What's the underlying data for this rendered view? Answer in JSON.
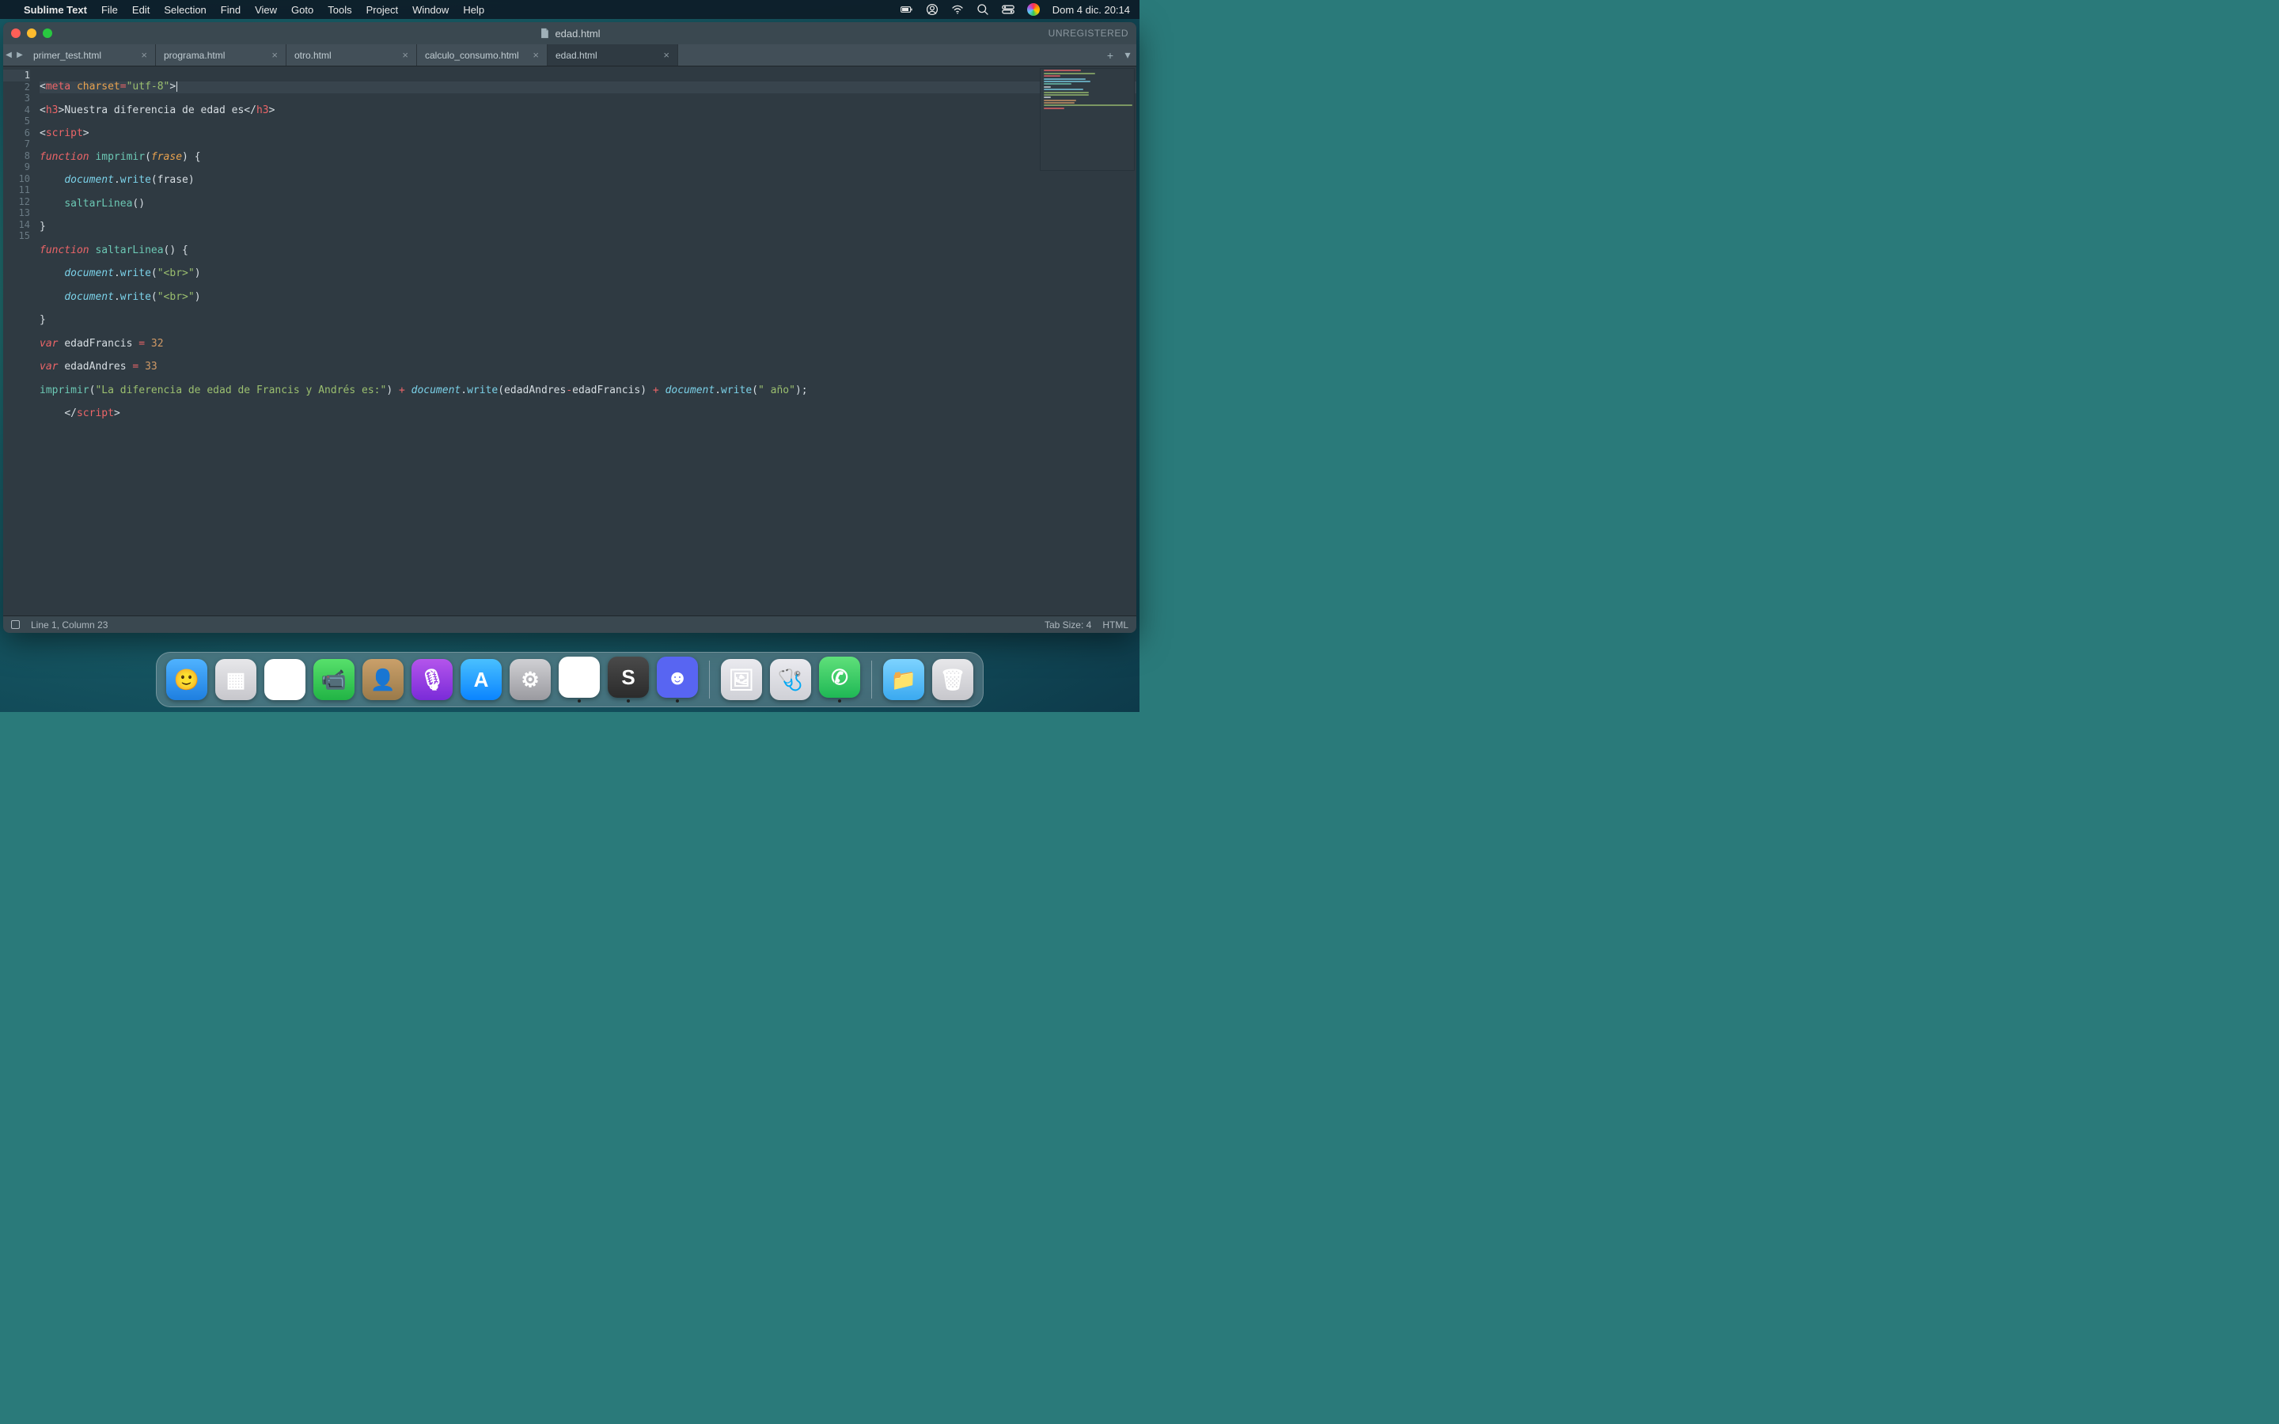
{
  "menubar": {
    "app": "Sublime Text",
    "items": [
      "File",
      "Edit",
      "Selection",
      "Find",
      "View",
      "Goto",
      "Tools",
      "Project",
      "Window",
      "Help"
    ],
    "clock": "Dom 4 dic.  20:14"
  },
  "window": {
    "title": "edad.html",
    "unregistered": "UNREGISTERED"
  },
  "tabs": [
    {
      "label": "primer_test.html",
      "active": false
    },
    {
      "label": "programa.html",
      "active": false
    },
    {
      "label": "otro.html",
      "active": false
    },
    {
      "label": "calculo_consumo.html",
      "active": false
    },
    {
      "label": "edad.html",
      "active": true
    }
  ],
  "code": {
    "lines": [
      "<meta charset=\"utf-8\">",
      "<h3>Nuestra diferencia de edad es</h3>",
      "<script>",
      "function imprimir(frase) {",
      "    document.write(frase)",
      "    saltarLinea()",
      "}",
      "function saltarLinea() {",
      "    document.write(\"<br>\")",
      "    document.write(\"<br>\")",
      "}",
      "var edadFrancis = 32",
      "var edadAndres = 33",
      "imprimir(\"La diferencia de edad de Francis y Andrés es:\") + document.write(edadAndres-edadFrancis) + document.write(\" año\");",
      "    </script>"
    ],
    "line_numbers": [
      "1",
      "2",
      "3",
      "4",
      "5",
      "6",
      "7",
      "8",
      "9",
      "10",
      "11",
      "12",
      "13",
      "14",
      "15"
    ]
  },
  "statusbar": {
    "pos": "Line 1, Column 23",
    "tabsize": "Tab Size: 4",
    "syntax": "HTML"
  },
  "dock": {
    "apps": [
      {
        "name": "finder",
        "bg": "linear-gradient(#4fb3ff,#1e7fe0)",
        "glyph": "🙂",
        "running": false
      },
      {
        "name": "launchpad",
        "bg": "linear-gradient(#e7e7ea,#c7c7cc)",
        "glyph": "▦",
        "running": false
      },
      {
        "name": "photos",
        "bg": "#fff",
        "glyph": "✿",
        "running": false
      },
      {
        "name": "facetime",
        "bg": "linear-gradient(#57e06b,#21b445)",
        "glyph": "📹",
        "running": false
      },
      {
        "name": "contacts",
        "bg": "linear-gradient(#caa06a,#9a7a4a)",
        "glyph": "👤",
        "running": false
      },
      {
        "name": "podcasts",
        "bg": "linear-gradient(#b455ec,#7a2bd8)",
        "glyph": "🎙",
        "running": false
      },
      {
        "name": "appstore",
        "bg": "linear-gradient(#49c0ff,#0a84ff)",
        "glyph": "A",
        "running": false
      },
      {
        "name": "settings",
        "bg": "linear-gradient(#d0d0d4,#9a9aa0)",
        "glyph": "⚙︎",
        "running": false
      },
      {
        "name": "chrome",
        "bg": "#fff",
        "glyph": "◎",
        "running": true
      },
      {
        "name": "sublime",
        "bg": "linear-gradient(#4a4a4a,#2b2b2b)",
        "glyph": "S",
        "running": true
      },
      {
        "name": "discord",
        "bg": "#5865F2",
        "glyph": "☻",
        "running": true
      }
    ],
    "apps2": [
      {
        "name": "preview",
        "bg": "linear-gradient(#eaeaef,#cfd0d6)",
        "glyph": "🖼",
        "running": false
      },
      {
        "name": "diskutil",
        "bg": "linear-gradient(#eaeaef,#cfd0d6)",
        "glyph": "🩺",
        "running": false
      },
      {
        "name": "whatsapp",
        "bg": "linear-gradient(#5fe07a,#1fb855)",
        "glyph": "✆",
        "running": true
      }
    ],
    "apps3": [
      {
        "name": "folder",
        "bg": "linear-gradient(#7dd3ff,#3aa9f0)",
        "glyph": "📁",
        "running": false
      },
      {
        "name": "trash",
        "bg": "linear-gradient(#e7e7ea,#c7c7cc)",
        "glyph": "🗑",
        "running": false
      }
    ]
  }
}
